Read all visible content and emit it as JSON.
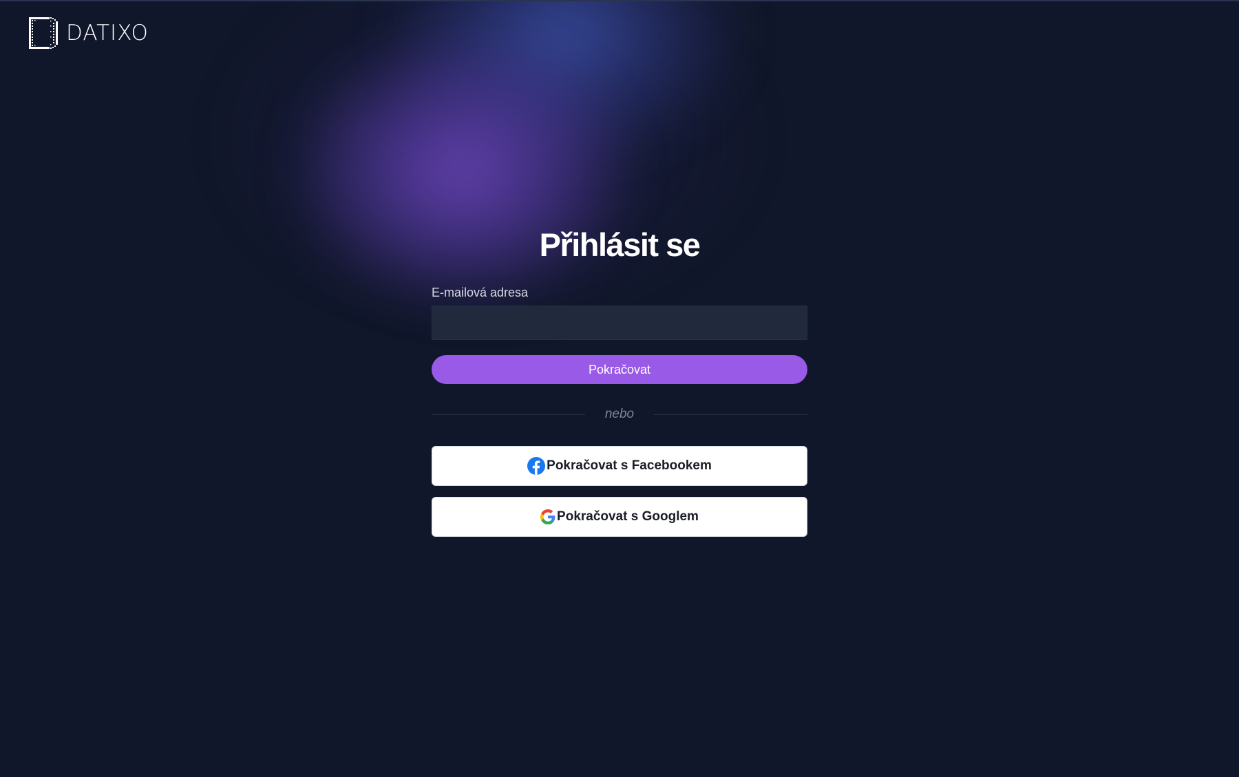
{
  "brand": {
    "name": "DATIXO",
    "icon": "datixo-logo-icon"
  },
  "login": {
    "title": "Přihlásit se",
    "email_label": "E-mailová adresa",
    "email_value": "",
    "email_placeholder": "",
    "continue_label": "Pokračovat",
    "divider_text": "nebo",
    "facebook_label": "Pokračovat s Facebookem",
    "facebook_icon": "facebook-icon",
    "google_label": "Pokračovat s Googlem",
    "google_icon": "google-icon"
  },
  "colors": {
    "background": "#11172a",
    "accent": "#9a5ae8",
    "input_bg": "#202a3c",
    "facebook_blue": "#1877f2"
  }
}
